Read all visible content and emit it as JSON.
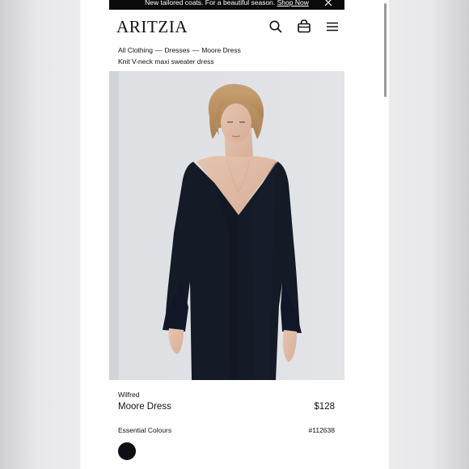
{
  "banner": {
    "message": "New tailored coats. For a beautiful season.",
    "link_label": "Shop Now"
  },
  "header": {
    "logo": "ARITZIA",
    "icons": [
      "search-icon",
      "shopping-bag-icon",
      "menu-icon"
    ]
  },
  "breadcrumb": {
    "items": [
      "All Clothing",
      "Dresses",
      "Moore Dress"
    ],
    "separator": "—"
  },
  "product": {
    "subtitle": "Knit V-neck maxi sweater dress",
    "brand": "Wilfred",
    "name": "Moore Dress",
    "price": "$128",
    "colour_section_label": "Essential Colours",
    "sku": "#112638",
    "swatches": [
      {
        "color": "#0e0f14",
        "selected": true
      }
    ]
  },
  "colors": {
    "banner_bg": "#0b0b0b",
    "text": "#111111",
    "dress": "#141a26"
  }
}
